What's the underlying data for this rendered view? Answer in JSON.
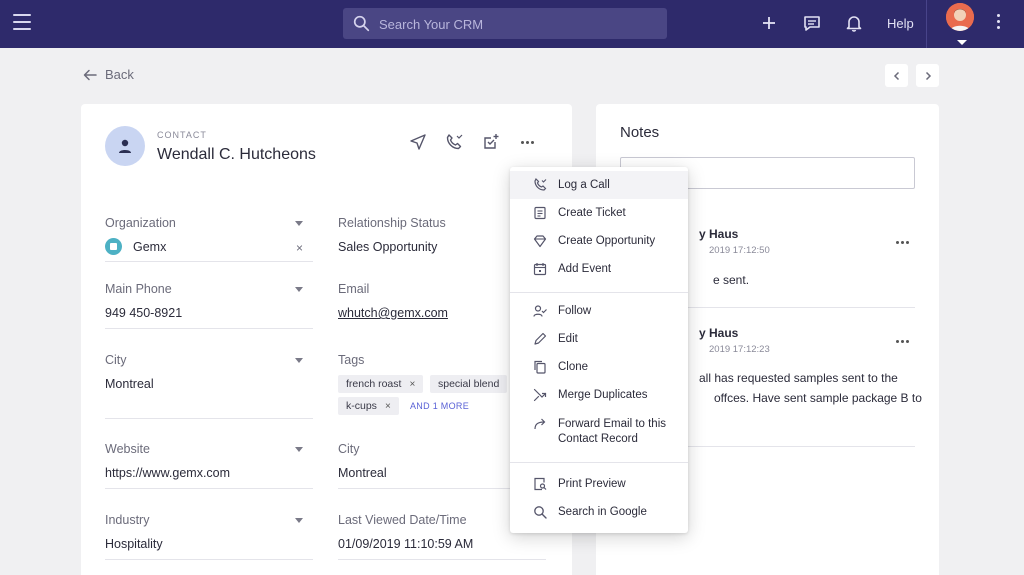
{
  "topbar": {
    "search_placeholder": "Search Your CRM",
    "help_label": "Help"
  },
  "nav": {
    "back_label": "Back"
  },
  "contact": {
    "type_label": "CONTACT",
    "name": "Wendall C. Hutcheons"
  },
  "fields": {
    "organization": {
      "label": "Organization",
      "value": "Gemx"
    },
    "relationship_status": {
      "label": "Relationship Status",
      "value": "Sales Opportunity"
    },
    "main_phone": {
      "label": "Main Phone",
      "value": "949 450-8921"
    },
    "email": {
      "label": "Email",
      "value": "whutch@gemx.com"
    },
    "city_left": {
      "label": "City",
      "value": "Montreal"
    },
    "tags": {
      "label": "Tags",
      "items": [
        "french roast",
        "special blend",
        "k-cups"
      ],
      "more_label": "AND 1 MORE"
    },
    "website": {
      "label": "Website",
      "value": "https://www.gemx.com"
    },
    "city_right": {
      "label": "City",
      "value": "Montreal"
    },
    "industry": {
      "label": "Industry",
      "value": "Hospitality"
    },
    "last_viewed": {
      "label": "Last Viewed Date/Time",
      "value": "01/09/2019 11:10:59 AM"
    }
  },
  "notes": {
    "title": "Notes",
    "items": [
      {
        "author": "y Haus",
        "time": "2019 17:12:50",
        "body": "e sent."
      },
      {
        "author": "y Haus",
        "time": "2019 17:12:23",
        "body_line1": "all has requested samples sent to the",
        "body_line2": "offces. Have sent sample package B to"
      }
    ]
  },
  "menu": {
    "log_call": "Log a Call",
    "create_ticket": "Create Ticket",
    "create_opportunity": "Create Opportunity",
    "add_event": "Add Event",
    "follow": "Follow",
    "edit": "Edit",
    "clone": "Clone",
    "merge_duplicates": "Merge Duplicates",
    "forward_email_line1": "Forward Email to this",
    "forward_email_line2": "Contact Record",
    "print_preview": "Print Preview",
    "search_google": "Search in Google"
  },
  "colors": {
    "topbar": "#2e2a6b",
    "search_bg": "#4a4684",
    "link_accent": "#5a62d6",
    "page_bg": "#f0f0f2"
  }
}
